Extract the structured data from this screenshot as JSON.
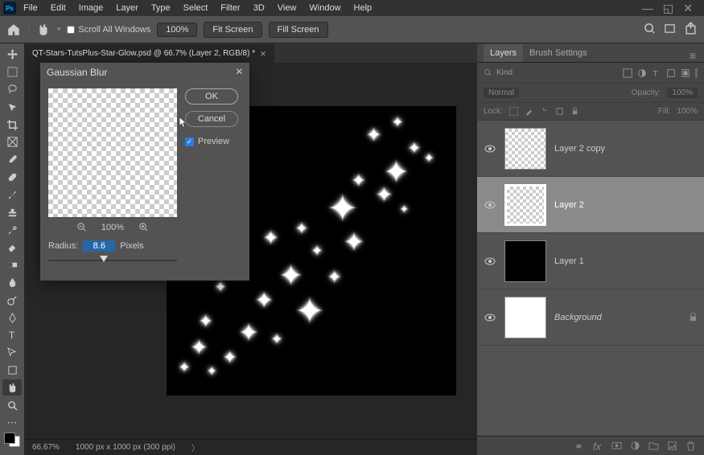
{
  "menu": [
    "File",
    "Edit",
    "Image",
    "Layer",
    "Type",
    "Select",
    "Filter",
    "3D",
    "View",
    "Window",
    "Help"
  ],
  "options": {
    "scroll_all": "Scroll All Windows",
    "zoom": "100%",
    "fit": "Fit Screen",
    "fill": "Fill Screen"
  },
  "doc_tab": "QT-Stars-TutsPlus-Star-Glow.psd @ 66.7% (Layer 2, RGB/8) *",
  "dialog": {
    "title": "Gaussian Blur",
    "ok": "OK",
    "cancel": "Cancel",
    "preview": "Preview",
    "zoom": "100%",
    "radius_label": "Radius:",
    "radius_value": "8.6",
    "radius_unit": "Pixels"
  },
  "layers_panel": {
    "tab1": "Layers",
    "tab2": "Brush Settings",
    "filter_label": "Kind",
    "blend_mode": "Normal",
    "opacity_label": "Opacity:",
    "opacity_val": "100%",
    "lock_label": "Lock:",
    "fill_label": "Fill:",
    "fill_val": "100%",
    "layers": [
      {
        "name": "Layer 2 copy",
        "thumb": "checker"
      },
      {
        "name": "Layer 2",
        "thumb": "checker",
        "selected": true
      },
      {
        "name": "Layer 1",
        "thumb": "black"
      },
      {
        "name": "Background",
        "thumb": "white",
        "locked": true,
        "italic": true
      }
    ]
  },
  "status": {
    "zoom": "66.67%",
    "doc": "1000 px x 1000 px (300 ppi)"
  }
}
